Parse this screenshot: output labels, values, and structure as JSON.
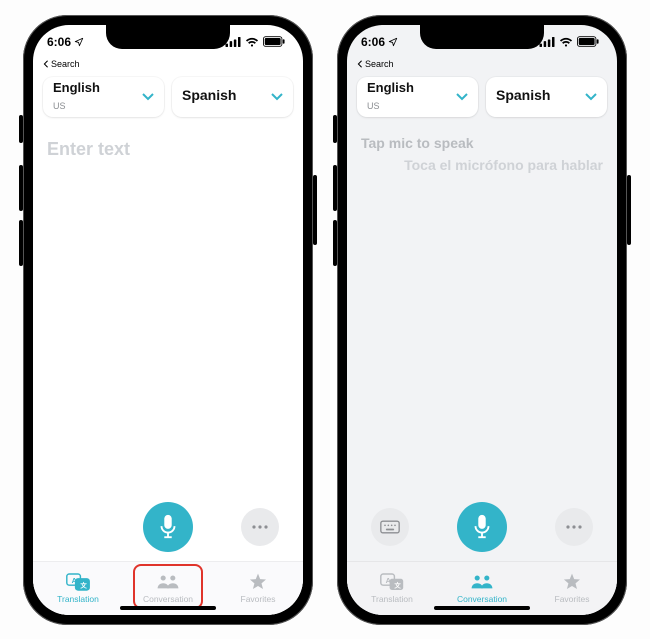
{
  "status": {
    "time": "6:06",
    "back_label": "Search"
  },
  "lang": {
    "from_name": "English",
    "from_sub": "US",
    "to_name": "Spanish"
  },
  "translation": {
    "placeholder": "Enter text"
  },
  "conversation": {
    "prompt_source": "Tap mic to speak",
    "prompt_target": "Toca el micrófono para hablar"
  },
  "tabs": {
    "translation": "Translation",
    "conversation": "Conversation",
    "favorites": "Favorites"
  },
  "colors": {
    "accent": "#33b4c9",
    "highlight": "#e0342b"
  }
}
